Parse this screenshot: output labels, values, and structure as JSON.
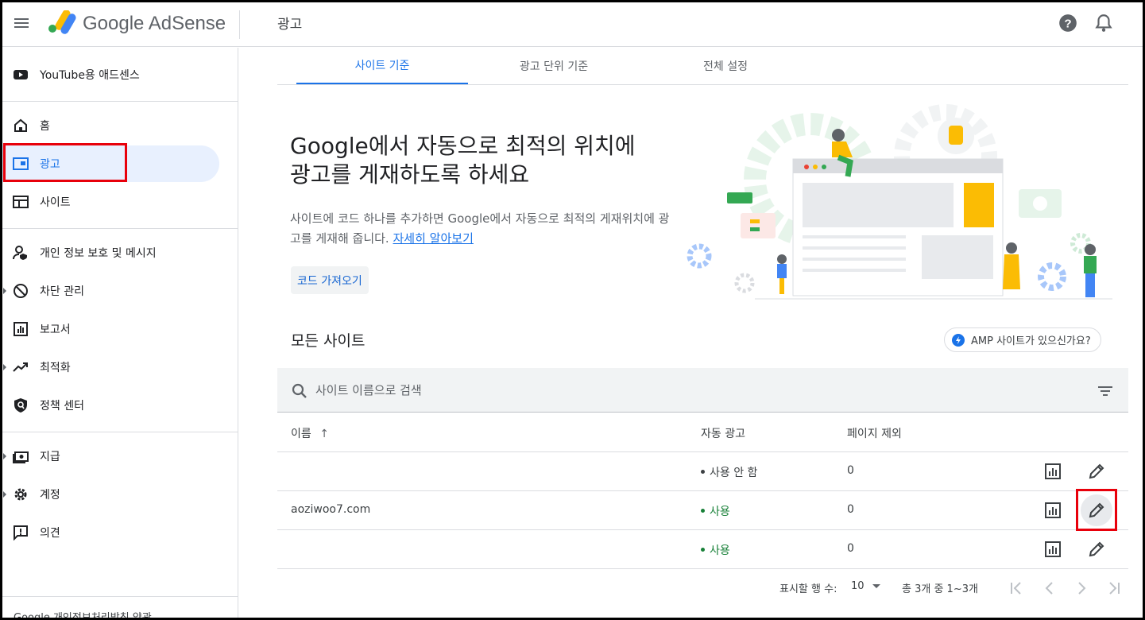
{
  "header": {
    "brand": "Google AdSense",
    "page_title": "광고"
  },
  "sidebar": {
    "youtube": "YouTube용 애드센스",
    "items": [
      {
        "label": "홈"
      },
      {
        "label": "광고"
      },
      {
        "label": "사이트"
      },
      {
        "label": "개인 정보 보호 및 메시지"
      },
      {
        "label": "차단 관리"
      },
      {
        "label": "보고서"
      },
      {
        "label": "최적화"
      },
      {
        "label": "정책 센터"
      },
      {
        "label": "지급"
      },
      {
        "label": "계정"
      },
      {
        "label": "의견"
      }
    ],
    "footer": "Google   개인정보처리방침   약관"
  },
  "tabs": [
    {
      "label": "사이트 기준"
    },
    {
      "label": "광고 단위 기준"
    },
    {
      "label": "전체 설정"
    }
  ],
  "hero": {
    "title_line1": "Google에서 자동으로 최적의 위치에",
    "title_line2": "광고를 게재하도록 하세요",
    "desc": "사이트에 코드 하나를 추가하면 Google에서 자동으로 최적의 게재위치에 광고를 게재해 줍니다.",
    "learn_more": "자세히 알아보기",
    "get_code": "코드 가져오기"
  },
  "sites": {
    "title": "모든 사이트",
    "amp_chip": "AMP 사이트가 있으신가요?",
    "search_placeholder": "사이트 이름으로 검색",
    "columns": {
      "name": "이름",
      "auto_ads": "자동 광고",
      "excluded_pages": "페이지 제외"
    },
    "sort_arrow": "↑",
    "rows": [
      {
        "name": "",
        "auto_ads": "사용 안 함",
        "excluded": "0"
      },
      {
        "name": "aoziwoo7.com",
        "auto_ads": "사용",
        "excluded": "0"
      },
      {
        "name": "",
        "auto_ads": "사용",
        "excluded": "0"
      }
    ]
  },
  "pagination": {
    "rows_label": "표시할 행 수:",
    "rows_value": "10",
    "range": "총 3개 중 1~3개"
  },
  "colors": {
    "accent": "#1a73e8",
    "active_bg": "#e8f0fe",
    "status_on": "#188038",
    "highlight": "#e8000b"
  }
}
